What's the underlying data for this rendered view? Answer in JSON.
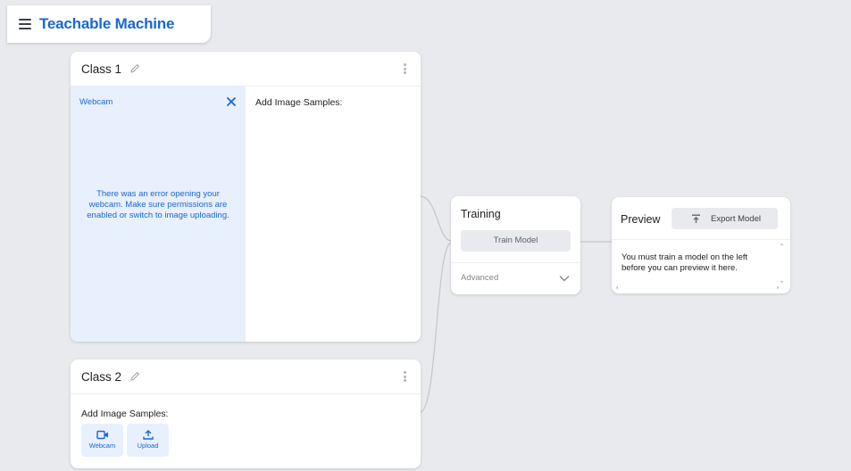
{
  "app": {
    "title": "Teachable Machine"
  },
  "classes": [
    {
      "name": "Class 1",
      "webcam": {
        "label": "Webcam",
        "error": "There was an error opening your webcam. Make sure permissions are enabled or switch to image uploading."
      },
      "samples_title": "Add Image Samples:"
    },
    {
      "name": "Class 2",
      "samples_title": "Add Image Samples:",
      "sources": [
        {
          "label": "Webcam",
          "icon": "webcam-icon"
        },
        {
          "label": "Upload",
          "icon": "upload-icon"
        }
      ]
    }
  ],
  "training": {
    "title": "Training",
    "train_button": "Train Model",
    "advanced_label": "Advanced"
  },
  "preview": {
    "title": "Preview",
    "export_button": "Export Model",
    "message": "You must train a model on the left before you can preview it here."
  },
  "colors": {
    "accent": "#1967d2",
    "webcam_pane": "#e8f0fe",
    "background": "#e8eaed"
  }
}
